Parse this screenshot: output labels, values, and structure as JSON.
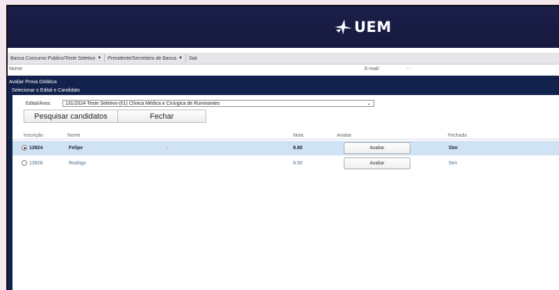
{
  "header": {
    "logo_text": "UEM",
    "logo_mark": "uem-star-icon",
    "bg": "#161a3f"
  },
  "menu": {
    "items": [
      {
        "label": "Banca Concurso Publico/Teste Seletivo",
        "has_caret": true
      },
      {
        "label": "Presidente/Secretário de Banca",
        "has_caret": true
      },
      {
        "label": "Sair",
        "has_caret": false
      }
    ]
  },
  "user": {
    "nome_label": "Nome:",
    "email_label": "E-mail:",
    "email_value": "-   -"
  },
  "panel": {
    "outer_title": "Avaliar Prova Didática",
    "inner_title": "Selecionar o Edital e Candidato",
    "edital_label": "Edital/Área:",
    "edital_value": "131/2024-Teste Seletivo-(01) Clínica Médica e Cirúrgica de Ruminantes",
    "buttons": {
      "search": "Pesquisar candidatos",
      "close": "Fechar"
    }
  },
  "table": {
    "headers": {
      "inscricao": "Inscrição",
      "nome": "Nome",
      "nota": "Nota",
      "avaliar": "Avaliar",
      "fechado": "Fechado"
    },
    "rows": [
      {
        "inscricao": "13924",
        "nome": "Felipe",
        "extra": "-",
        "nota": "8.80",
        "avaliar": "Avaliar",
        "fechado": "Sim",
        "selected": true
      },
      {
        "inscricao": "13928",
        "nome": "Rodrigo",
        "extra": "",
        "nota": "8.50",
        "avaliar": "Avaliar",
        "fechado": "Sim",
        "selected": false
      }
    ]
  },
  "colors": {
    "panel": "#13224d",
    "selected_row": "#cfe3f4",
    "page_bg": "#f5e7ee"
  }
}
